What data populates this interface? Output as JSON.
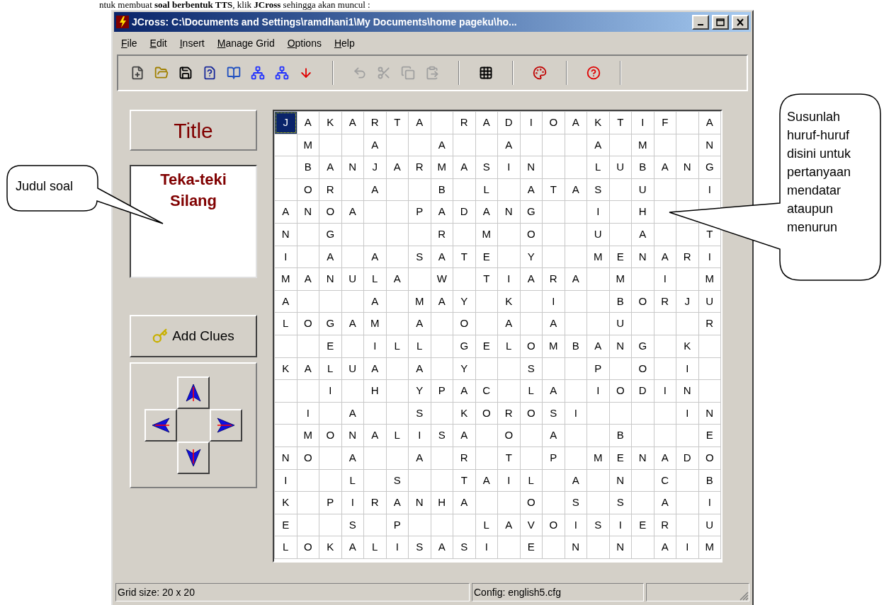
{
  "document_line": "ntuk membuat **soal berbentuk TTS**, klik **JCross** sehingga akan muncul :",
  "window": {
    "title": "JCross: C:\\Documents and Settings\\ramdhani1\\My Documents\\home pageku\\ho..."
  },
  "menu": [
    "File",
    "Edit",
    "Insert",
    "Manage Grid",
    "Options",
    "Help"
  ],
  "toolbar": [
    [
      {
        "kind": "new",
        "disabled": false
      },
      {
        "kind": "open",
        "disabled": false
      },
      {
        "kind": "save",
        "disabled": false
      },
      {
        "kind": "save-as",
        "disabled": false
      },
      {
        "kind": "book",
        "disabled": false
      },
      {
        "kind": "net",
        "disabled": false
      },
      {
        "kind": "net",
        "disabled": false
      },
      {
        "kind": "down",
        "disabled": false
      }
    ],
    [
      {
        "kind": "undo",
        "disabled": true
      },
      {
        "kind": "cut",
        "disabled": true
      },
      {
        "kind": "copy",
        "disabled": true
      },
      {
        "kind": "paste",
        "disabled": true
      }
    ],
    [
      {
        "kind": "grid",
        "disabled": false
      }
    ],
    [
      {
        "kind": "palette",
        "disabled": false
      }
    ],
    [
      {
        "kind": "help",
        "disabled": false
      }
    ]
  ],
  "title_button": "Title",
  "title_text": "Teka-teki Silang",
  "add_clues_button": "Add Clues",
  "grid": {
    "cursor_on_first_cell": true,
    "rows": [
      [
        "J",
        "A",
        "K",
        "A",
        "R",
        "T",
        "A",
        null,
        "R",
        "A",
        "D",
        "I",
        "O",
        "A",
        "K",
        "T",
        "I",
        "F",
        null,
        "A"
      ],
      [
        null,
        "M",
        null,
        null,
        "A",
        null,
        null,
        "A",
        null,
        null,
        "A",
        null,
        null,
        null,
        "A",
        null,
        "M",
        null,
        null,
        "N"
      ],
      [
        null,
        "B",
        "A",
        "N",
        "J",
        "A",
        "R",
        "M",
        "A",
        "S",
        "I",
        "N",
        null,
        null,
        "L",
        "U",
        "B",
        "A",
        "N",
        "G"
      ],
      [
        null,
        "O",
        "R",
        null,
        "A",
        null,
        null,
        "B",
        null,
        "L",
        null,
        "A",
        "T",
        "A",
        "S",
        null,
        "U",
        null,
        null,
        "I"
      ],
      [
        "A",
        "N",
        "O",
        "A",
        null,
        null,
        "P",
        "A",
        "D",
        "A",
        "N",
        "G",
        null,
        null,
        "I",
        null,
        "H",
        null,
        null,
        null
      ],
      [
        "N",
        null,
        "G",
        null,
        null,
        null,
        null,
        "R",
        null,
        "M",
        null,
        "O",
        null,
        null,
        "U",
        null,
        "A",
        null,
        null,
        "T"
      ],
      [
        "I",
        null,
        "A",
        null,
        "A",
        null,
        "S",
        "A",
        "T",
        "E",
        null,
        "Y",
        null,
        null,
        "M",
        "E",
        "N",
        "A",
        "R",
        "I"
      ],
      [
        "M",
        "A",
        "N",
        "U",
        "L",
        "A",
        null,
        "W",
        null,
        "T",
        "I",
        "A",
        "R",
        "A",
        null,
        "M",
        null,
        "I",
        null,
        "M"
      ],
      [
        "A",
        null,
        null,
        null,
        "A",
        null,
        "M",
        "A",
        "Y",
        null,
        "K",
        null,
        "I",
        null,
        null,
        "B",
        "O",
        "R",
        "J",
        "U"
      ],
      [
        "L",
        "O",
        "G",
        "A",
        "M",
        null,
        "A",
        null,
        "O",
        null,
        "A",
        null,
        "A",
        null,
        null,
        "U",
        null,
        null,
        null,
        "R"
      ],
      [
        null,
        null,
        "E",
        null,
        "I",
        "L",
        "L",
        null,
        "G",
        "E",
        "L",
        "O",
        "M",
        "B",
        "A",
        "N",
        "G",
        null,
        "K",
        null
      ],
      [
        "K",
        "A",
        "L",
        "U",
        "A",
        null,
        "A",
        null,
        "Y",
        null,
        null,
        "S",
        null,
        null,
        "P",
        null,
        "O",
        null,
        "I",
        null
      ],
      [
        null,
        null,
        "I",
        null,
        "H",
        null,
        "Y",
        "P",
        "A",
        "C",
        null,
        "L",
        "A",
        null,
        "I",
        "O",
        "D",
        "I",
        "N",
        null
      ],
      [
        null,
        "I",
        null,
        "A",
        null,
        null,
        "S",
        null,
        "K",
        "O",
        "R",
        "O",
        "S",
        "I",
        null,
        null,
        null,
        null,
        "I",
        "N"
      ],
      [
        null,
        "M",
        "O",
        "N",
        "A",
        "L",
        "I",
        "S",
        "A",
        null,
        "O",
        null,
        "A",
        null,
        null,
        "B",
        null,
        null,
        null,
        "E"
      ],
      [
        "N",
        "O",
        null,
        "A",
        null,
        null,
        "A",
        null,
        "R",
        null,
        "T",
        null,
        "P",
        null,
        "M",
        "E",
        "N",
        "A",
        "D",
        "O"
      ],
      [
        "I",
        null,
        null,
        "L",
        null,
        "S",
        null,
        null,
        "T",
        "A",
        "I",
        "L",
        null,
        "A",
        null,
        "N",
        null,
        "C",
        null,
        "B"
      ],
      [
        "K",
        null,
        "P",
        "I",
        "R",
        "A",
        "N",
        "H",
        "A",
        null,
        null,
        "O",
        null,
        "S",
        null,
        "S",
        null,
        "A",
        null,
        "I"
      ],
      [
        "E",
        null,
        null,
        "S",
        null,
        "P",
        null,
        null,
        null,
        "L",
        "A",
        "V",
        "O",
        "I",
        "S",
        "I",
        "E",
        "R",
        null,
        "U"
      ],
      [
        "L",
        "O",
        "K",
        "A",
        "L",
        "I",
        "S",
        "A",
        "S",
        "I",
        null,
        "E",
        null,
        "N",
        null,
        "N",
        null,
        "A",
        "I",
        "M"
      ]
    ]
  },
  "status_bar": [
    "Grid size: 20 x 20",
    "Config: english5.cfg"
  ],
  "callouts": [
    {
      "text": "Judul soal"
    },
    {
      "text": "Susunlah huruf-huruf disini untuk pertanyaan mendatar ataupun menurun"
    }
  ]
}
